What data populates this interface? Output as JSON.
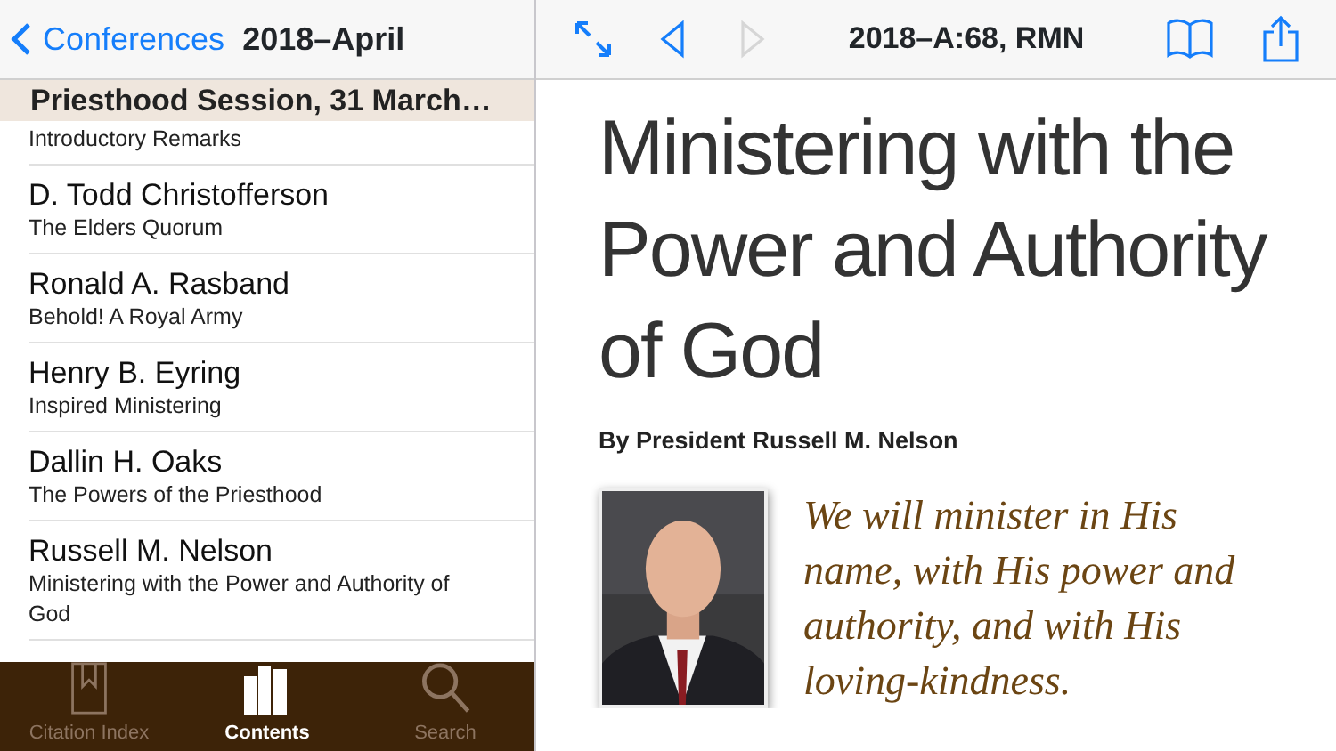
{
  "left_nav": {
    "back_label": "Conferences",
    "title": "2018–April"
  },
  "section_header": "Priesthood Session, 31 March…",
  "talks": [
    {
      "subtitle": "Introductory Remarks"
    },
    {
      "speaker": "D. Todd Christofferson",
      "subtitle": "The Elders Quorum"
    },
    {
      "speaker": "Ronald A. Rasband",
      "subtitle": "Behold! A Royal Army"
    },
    {
      "speaker": "Henry B. Eyring",
      "subtitle": "Inspired Ministering"
    },
    {
      "speaker": "Dallin H. Oaks",
      "subtitle": "The Powers of the Priesthood"
    },
    {
      "speaker": "Russell M. Nelson",
      "subtitle": "Ministering with the Power and Authority of God"
    }
  ],
  "tab_bar": [
    {
      "kind": "bookmark",
      "label": "Citation Index",
      "selected": false
    },
    {
      "kind": "books",
      "label": "Contents",
      "selected": true
    },
    {
      "kind": "search",
      "label": "Search",
      "selected": false
    }
  ],
  "toolbar": {
    "citation": "2018–A:68, RMN",
    "back_disabled": false,
    "forward_disabled": true
  },
  "article": {
    "title": "Ministering with the Power and Authority of God",
    "byline": "By President Russell M. Nelson",
    "quote": "We will minister in His name, with His power and authority, and with His loving-kindness."
  }
}
